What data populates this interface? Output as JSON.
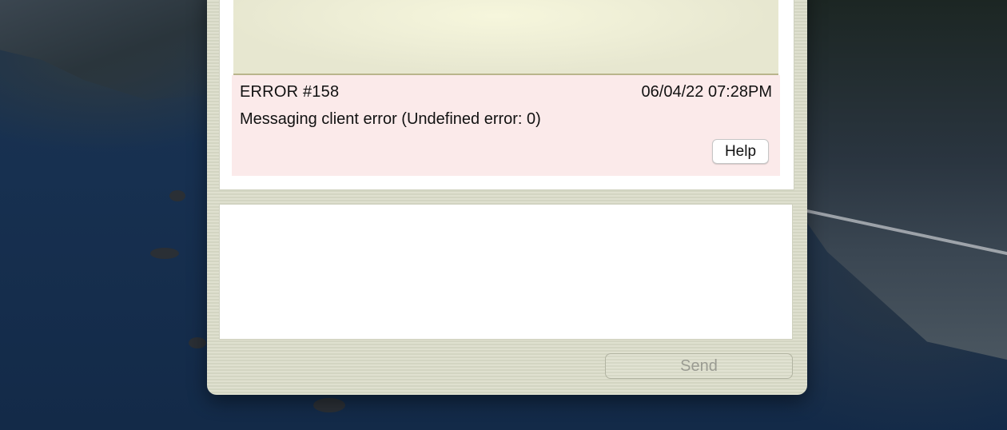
{
  "error": {
    "title": "ERROR #158",
    "timestamp": "06/04/22 07:28PM",
    "message": "Messaging client error (Undefined error: 0)",
    "help_label": "Help"
  },
  "compose": {
    "value": "",
    "send_label": "Send",
    "send_enabled": false
  }
}
